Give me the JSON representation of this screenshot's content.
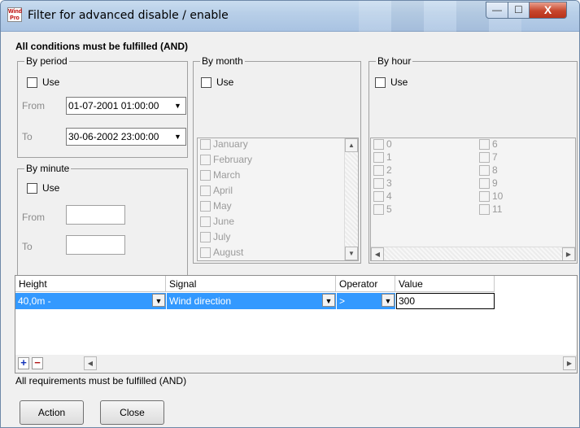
{
  "window": {
    "title": "Filter for advanced disable / enable",
    "icon_text": "Wind Pro",
    "controls": {
      "minimize": "—",
      "maximize": "☐",
      "close": "X"
    }
  },
  "header": "All conditions must be fulfilled (AND)",
  "period": {
    "label": "By period",
    "use_label": "Use",
    "use_checked": false,
    "from_label": "From",
    "from_value": "01-07-2001 01:00:00",
    "to_label": "To",
    "to_value": "30-06-2002 23:00:00"
  },
  "minute": {
    "label": "By minute",
    "use_label": "Use",
    "use_checked": false,
    "from_label": "From",
    "from_value": "",
    "to_label": "To",
    "to_value": ""
  },
  "month": {
    "label": "By month",
    "use_label": "Use",
    "use_checked": false,
    "items": [
      "January",
      "February",
      "March",
      "April",
      "May",
      "June",
      "July",
      "August"
    ]
  },
  "hour": {
    "label": "By hour",
    "use_label": "Use",
    "use_checked": false,
    "items_col1": [
      "0",
      "1",
      "2",
      "3",
      "4",
      "5"
    ],
    "items_col2": [
      "6",
      "7",
      "8",
      "9",
      "10",
      "11"
    ]
  },
  "grid": {
    "columns": [
      "Height",
      "Signal",
      "Operator",
      "Value"
    ],
    "rows": [
      {
        "height": "40,0m -",
        "signal": "Wind direction",
        "operator": ">",
        "value": "300"
      }
    ],
    "add_label": "+",
    "remove_label": "−"
  },
  "footer_text": "All requirements must be fulfilled (AND)",
  "buttons": {
    "action": "Action",
    "close": "Close"
  },
  "colors": {
    "selection": "#3399ff",
    "title_bar": "#b8cfe8",
    "close_button": "#c7462c"
  }
}
